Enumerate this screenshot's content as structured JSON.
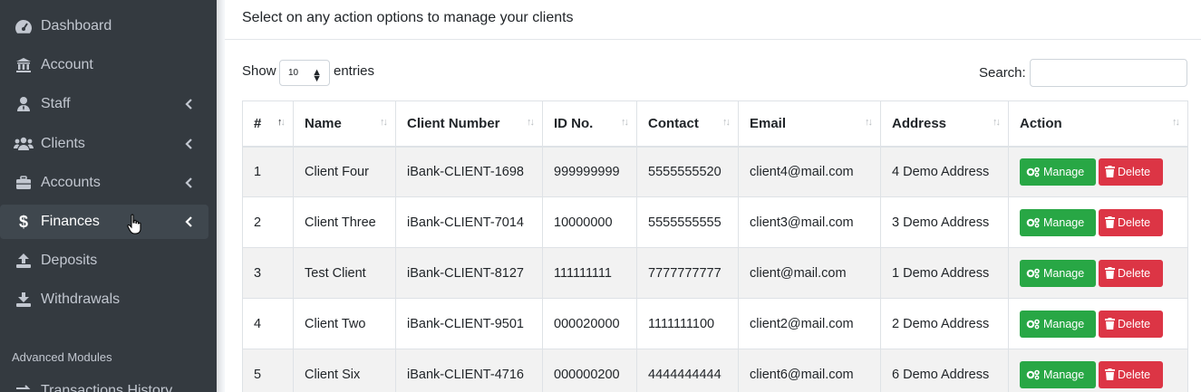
{
  "sidebar": {
    "items": [
      {
        "label": "Dashboard",
        "icon": "dashboard-icon",
        "submenu": false
      },
      {
        "label": "Account",
        "icon": "bank-icon",
        "submenu": false
      },
      {
        "label": "Staff",
        "icon": "user-tie-icon",
        "submenu": true
      },
      {
        "label": "Clients",
        "icon": "users-icon",
        "submenu": true
      },
      {
        "label": "Accounts",
        "icon": "briefcase-icon",
        "submenu": true
      },
      {
        "label": "Finances",
        "icon": "dollar-icon",
        "submenu": true,
        "active": true
      },
      {
        "label": "Deposits",
        "icon": "upload-icon",
        "submenu": false
      },
      {
        "label": "Withdrawals",
        "icon": "download-icon",
        "submenu": false
      }
    ],
    "header": "Advanced Modules",
    "partial_item": "Transactions History"
  },
  "main": {
    "title": "Select on any action options to manage your clients",
    "length": {
      "show_label": "Show",
      "value": "10",
      "entries_label": "entries"
    },
    "search": {
      "label": "Search:",
      "value": ""
    }
  },
  "table": {
    "columns": [
      "#",
      "Name",
      "Client Number",
      "ID No.",
      "Contact",
      "Email",
      "Address",
      "Action"
    ],
    "rows": [
      [
        "1",
        "Client Four",
        "iBank-CLIENT-1698",
        "999999999",
        "5555555520",
        "client4@mail.com",
        "4 Demo Address"
      ],
      [
        "2",
        "Client Three",
        "iBank-CLIENT-7014",
        "10000000",
        "5555555555",
        "client3@mail.com",
        "3 Demo Address"
      ],
      [
        "3",
        "Test Client",
        "iBank-CLIENT-8127",
        "111111111",
        "7777777777",
        "client@mail.com",
        "1 Demo Address"
      ],
      [
        "4",
        "Client Two",
        "iBank-CLIENT-9501",
        "000020000",
        "1111111100",
        "client2@mail.com",
        "2 Demo Address"
      ],
      [
        "5",
        "Client Six",
        "iBank-CLIENT-4716",
        "000000200",
        "4444444444",
        "client6@mail.com",
        "6 Demo Address"
      ]
    ],
    "actions": {
      "manage": "Manage",
      "delete": "Delete"
    }
  },
  "colors": {
    "sidebar_bg": "#343a40",
    "manage_btn": "#28a745",
    "delete_btn": "#dc3545"
  }
}
